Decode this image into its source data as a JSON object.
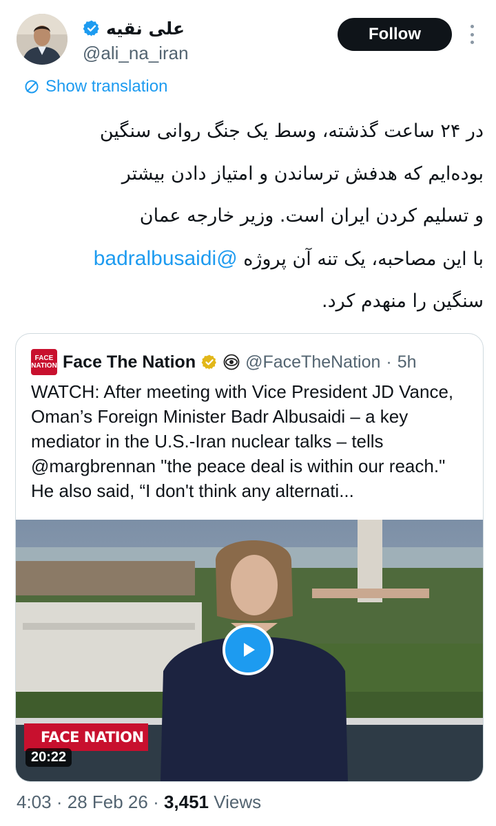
{
  "author": {
    "display_name": "علی نقیه",
    "handle": "@ali_na_iran",
    "verified": true
  },
  "follow_label": "Follow",
  "translation_label": "Show translation",
  "tweet": {
    "lines": [
      "در ۲۴ ساعت گذشته، وسط یک جنگ روانی سنگین",
      "بوده‌ایم که هدفش ترساندن و امتیاز دادن بیشتر",
      "و تسلیم کردن ایران است. وزیر خارجه عمان",
      "با این مصاحبه، یک تنه آن پروژه",
      "سنگین را منهدم کرد."
    ],
    "mention": "@badralbusaidi"
  },
  "quote": {
    "logo_text_1": "FACE",
    "logo_text_2": "NATION",
    "name": "Face The Nation",
    "handle": "@FaceTheNation",
    "time": "5h",
    "text": "WATCH: After meeting with Vice President JD Vance, Oman’s Foreign Minister Badr Albusaidi – a key mediator in the U.S.-Iran nuclear talks – tells @margbrennan \"the peace deal is within our reach.\" He also said, “I don't think any alternati...",
    "video_duration": "20:22",
    "lower_third": "FACE NATION"
  },
  "meta": {
    "time": "4:03",
    "date": "28 Feb 26",
    "views_count": "3,451",
    "views_label": "Views"
  },
  "colors": {
    "accent": "#1d9bf0",
    "text": "#0f1419",
    "muted": "#536471",
    "cbs_red": "#c8102e"
  }
}
